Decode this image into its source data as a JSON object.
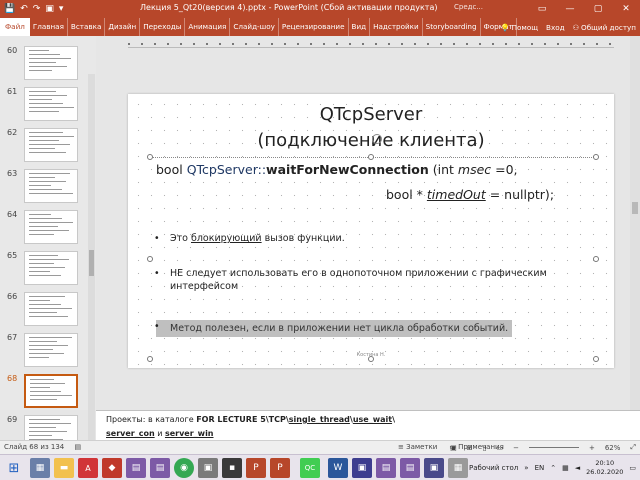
{
  "window": {
    "title": "Лекция 5_Qt20(версия 4).pptx - PowerPoint (Сбой активации продукта)",
    "account": "Средс...",
    "minimize": "—",
    "restore": "▢",
    "close": "✕"
  },
  "ribbon": {
    "tabs": [
      "Файл",
      "Главная",
      "Вставка",
      "Дизайн",
      "Переходы",
      "Анимация",
      "Слайд-шоу",
      "Рецензирование",
      "Вид",
      "Надстройки",
      "Storyboarding",
      "Формат"
    ],
    "help": "Помощ",
    "signin": "Вход",
    "share": "Общий доступ"
  },
  "thumbnails": [
    {
      "num": "60"
    },
    {
      "num": "61"
    },
    {
      "num": "62"
    },
    {
      "num": "63"
    },
    {
      "num": "64"
    },
    {
      "num": "65"
    },
    {
      "num": "66"
    },
    {
      "num": "67"
    },
    {
      "num": "68",
      "selected": true
    },
    {
      "num": "69"
    }
  ],
  "slide": {
    "title_line1": "QTcpServer",
    "title_line2": "(подключение клиента)",
    "sig": {
      "p1": "bool",
      "p2": "QTcpServer::",
      "p3": "waitForNewConnection",
      "p4": " (int ",
      "p5": "msec",
      "p6": " =0,",
      "p7": "bool * ",
      "p8": "timedOut",
      "p9": " = nullptr);"
    },
    "bullet1": {
      "a": "Это ",
      "b": "блокирующий",
      "c": " вызов функции."
    },
    "bullet2": "НЕ следует использовать его в однопоточном приложении с графическим интерфейсом",
    "bullet3": "Метод полезен, если в приложении  нет цикла обработки событий.",
    "footer": "Костина Н."
  },
  "notes": {
    "line1_a": "Проекты:  в каталоге ",
    "line1_b": "FOR LECTURE 5\\TCP\\",
    "line1_c": "single_thread",
    "line1_d": "\\",
    "line1_e": "use_wait",
    "line1_f": "\\",
    "line2_a": "server_con",
    "line2_b": " и  ",
    "line2_c": "server_win"
  },
  "status": {
    "slide_info": "Слайд 68 из 134",
    "notes_btn": "Заметки",
    "comments_btn": "Примечания",
    "zoom": "62%"
  },
  "taskbar": {
    "desktop": "Рабочий стол",
    "lang": "EN",
    "time": "20:10",
    "date": "26.02.2020"
  },
  "colors": {
    "accent": "#b7472a",
    "selection": "#c55a11"
  }
}
